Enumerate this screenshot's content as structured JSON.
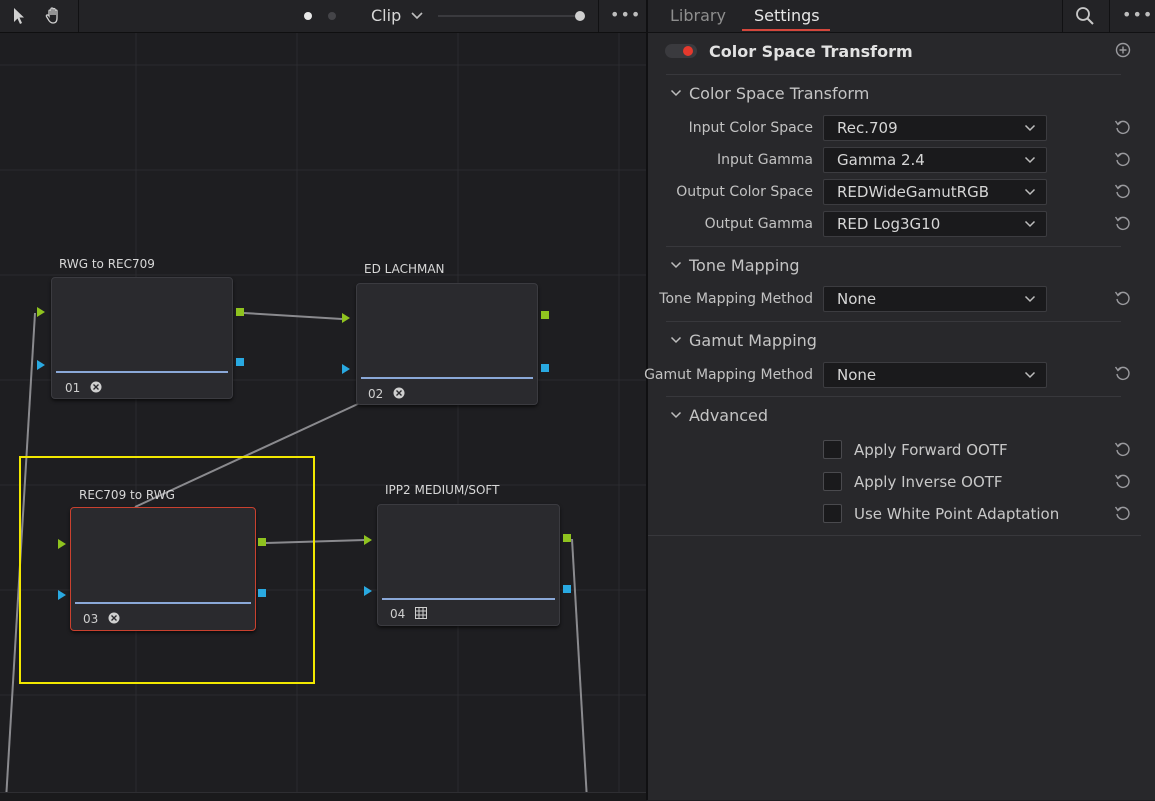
{
  "toolbar": {
    "clip_label": "Clip"
  },
  "nodes": [
    {
      "title": "RWG to REC709",
      "number": "01",
      "icon": "fx-icon"
    },
    {
      "title": "ED LACHMAN",
      "number": "02",
      "icon": "fx-icon"
    },
    {
      "title": "REC709 to RWG",
      "number": "03",
      "icon": "fx-icon",
      "selected": true
    },
    {
      "title": "IPP2 MEDIUM/SOFT",
      "number": "04",
      "icon": "lut-grid-icon"
    }
  ],
  "panel": {
    "tabs": {
      "library": "Library",
      "settings": "Settings"
    },
    "active_tab": "Settings",
    "effect_title": "Color Space Transform",
    "effect_enabled": true,
    "sections": {
      "cst": {
        "title": "Color Space Transform",
        "fields": [
          {
            "label": "Input Color Space",
            "value": "Rec.709"
          },
          {
            "label": "Input Gamma",
            "value": "Gamma 2.4"
          },
          {
            "label": "Output Color Space",
            "value": "REDWideGamutRGB"
          },
          {
            "label": "Output Gamma",
            "value": "RED Log3G10"
          }
        ]
      },
      "tone": {
        "title": "Tone Mapping",
        "fields": [
          {
            "label": "Tone Mapping Method",
            "value": "None"
          }
        ]
      },
      "gamut": {
        "title": "Gamut Mapping",
        "fields": [
          {
            "label": "Gamut Mapping Method",
            "value": "None"
          }
        ]
      },
      "advanced": {
        "title": "Advanced",
        "checkboxes": [
          {
            "label": "Apply Forward OOTF",
            "checked": false
          },
          {
            "label": "Apply Inverse OOTF",
            "checked": false
          },
          {
            "label": "Use White Point Adaptation",
            "checked": false
          }
        ]
      }
    }
  },
  "colors": {
    "accent_red": "#d4473c",
    "selection_yellow": "#f2e800",
    "port_green": "#8fc31f",
    "port_blue": "#29a9e1"
  }
}
